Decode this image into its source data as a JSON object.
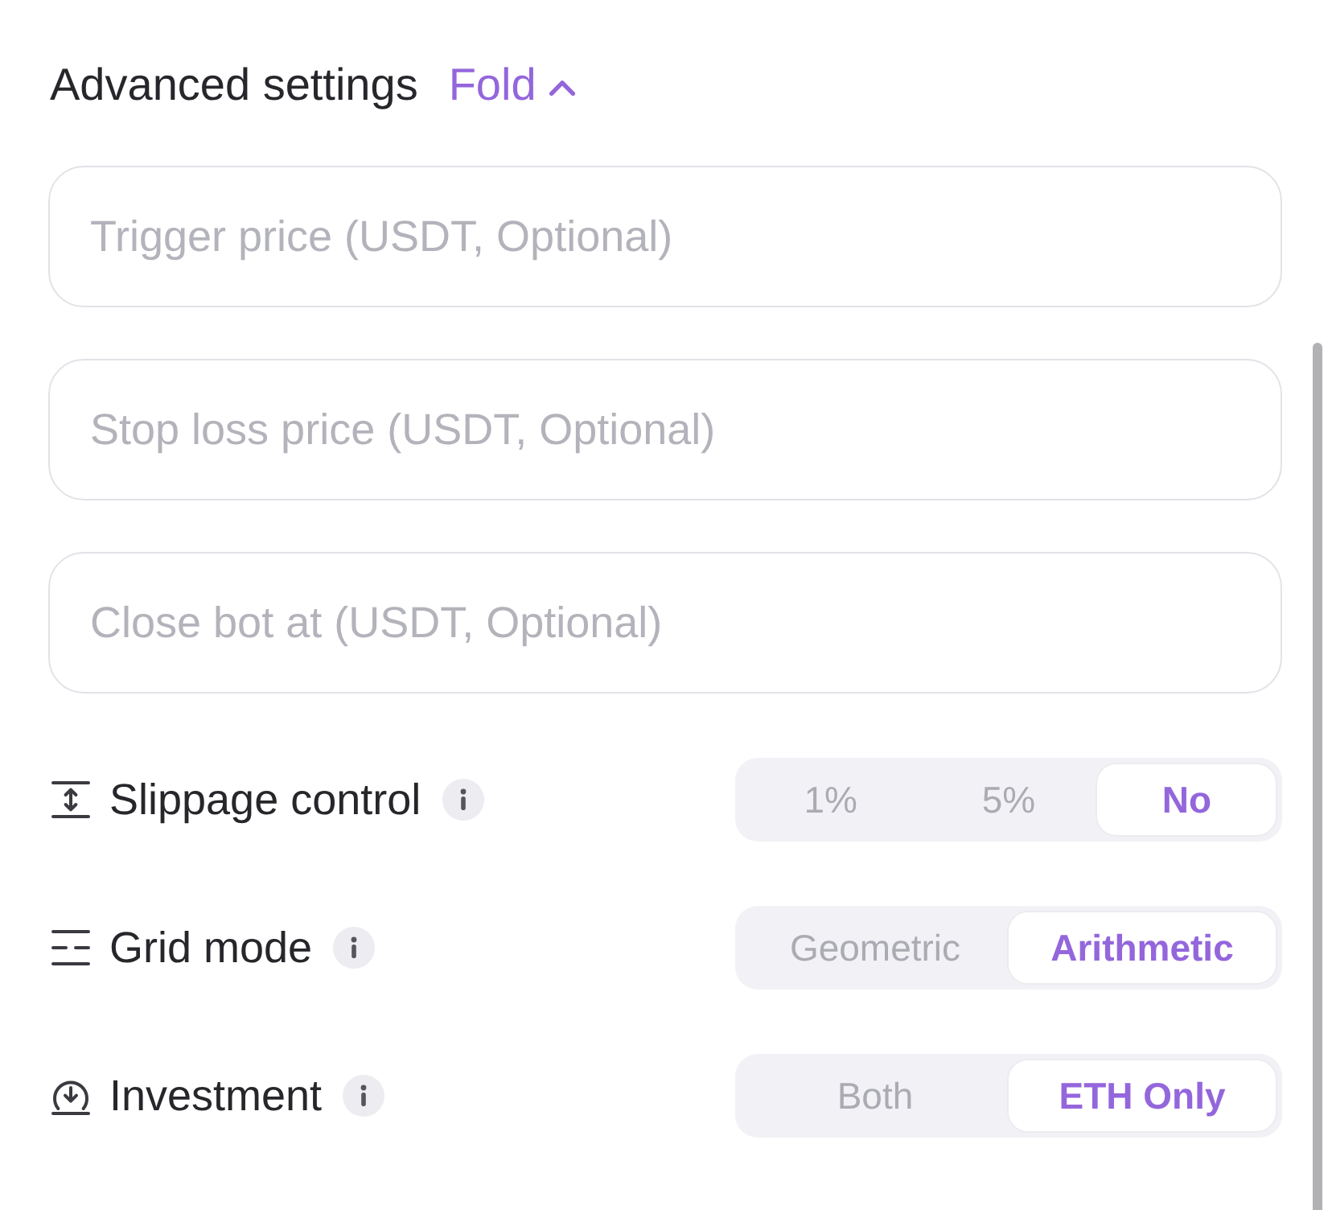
{
  "header": {
    "title": "Advanced settings",
    "toggle": {
      "label": "Fold",
      "expanded": true
    }
  },
  "fields": [
    {
      "placeholder": "Trigger price (USDT, Optional)"
    },
    {
      "placeholder": "Stop loss price (USDT, Optional)"
    },
    {
      "placeholder": "Close bot at (USDT, Optional)"
    }
  ],
  "settings": [
    {
      "kind": "slippage",
      "label": "Slippage control",
      "options": [
        {
          "label": "1%",
          "selected": false
        },
        {
          "label": "5%",
          "selected": false
        },
        {
          "label": "No",
          "selected": true
        }
      ]
    },
    {
      "kind": "grid",
      "label": "Grid mode",
      "options": [
        {
          "label": "Geometric",
          "selected": false
        },
        {
          "label": "Arithmetic",
          "selected": true
        }
      ]
    },
    {
      "kind": "investment",
      "label": "Investment",
      "options": [
        {
          "label": "Both",
          "selected": false
        },
        {
          "label": "ETH Only",
          "selected": true
        }
      ]
    }
  ]
}
